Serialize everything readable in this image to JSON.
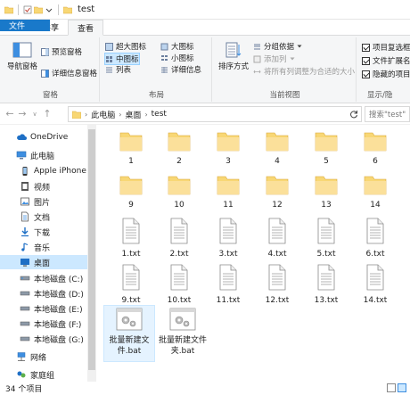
{
  "window": {
    "title": "test"
  },
  "tabs": [
    {
      "label": "文件"
    },
    {
      "label": "主页"
    },
    {
      "label": "共享"
    },
    {
      "label": "查看"
    }
  ],
  "ribbon": {
    "pane": {
      "nav_pane": "导航窗格",
      "preview": "预览窗格",
      "details": "详细信息窗格",
      "group": "窗格"
    },
    "layout": {
      "extra_large": "超大图标",
      "large": "大图标",
      "medium": "中图标",
      "small": "小图标",
      "list": "列表",
      "details": "详细信息",
      "group": "布局"
    },
    "current_view": {
      "sort": "排序方式",
      "group_by": "分组依据",
      "add_column": "添加列",
      "fit_columns": "将所有列调整为合适的大小",
      "group": "当前视图"
    },
    "show_hide": {
      "item_checkboxes": "项目复选框",
      "extensions": "文件扩展名",
      "hidden_items": "隐藏的项目",
      "group": "显示/隐"
    }
  },
  "address": {
    "crumbs": [
      "此电脑",
      "桌面",
      "test"
    ],
    "search_placeholder": "搜索\"test\""
  },
  "nav": {
    "items": [
      {
        "label": "OneDrive"
      },
      {
        "label": "此电脑"
      },
      {
        "label": "Apple iPhone"
      },
      {
        "label": "视频"
      },
      {
        "label": "图片"
      },
      {
        "label": "文档"
      },
      {
        "label": "下载"
      },
      {
        "label": "音乐"
      },
      {
        "label": "桌面"
      },
      {
        "label": "本地磁盘 (C:)"
      },
      {
        "label": "本地磁盘 (D:)"
      },
      {
        "label": "本地磁盘 (E:)"
      },
      {
        "label": "本地磁盘 (F:)"
      },
      {
        "label": "本地磁盘 (G:)"
      },
      {
        "label": "网络"
      },
      {
        "label": "家庭组"
      }
    ]
  },
  "files": {
    "folders": [
      "1",
      "2",
      "3",
      "4",
      "5",
      "6",
      "9",
      "10",
      "11",
      "12",
      "13",
      "14"
    ],
    "txt": [
      "1.txt",
      "2.txt",
      "3.txt",
      "4.txt",
      "5.txt",
      "6.txt",
      "9.txt",
      "10.txt",
      "11.txt",
      "12.txt",
      "13.txt",
      "14.txt"
    ],
    "bat": [
      "批量新建文件.bat",
      "批量新建文件夹.bat"
    ]
  },
  "status": {
    "count": "34 个项目"
  },
  "colors": {
    "accent": "#1979ca",
    "folder": "#f8d775",
    "selection": "#cce8ff"
  }
}
